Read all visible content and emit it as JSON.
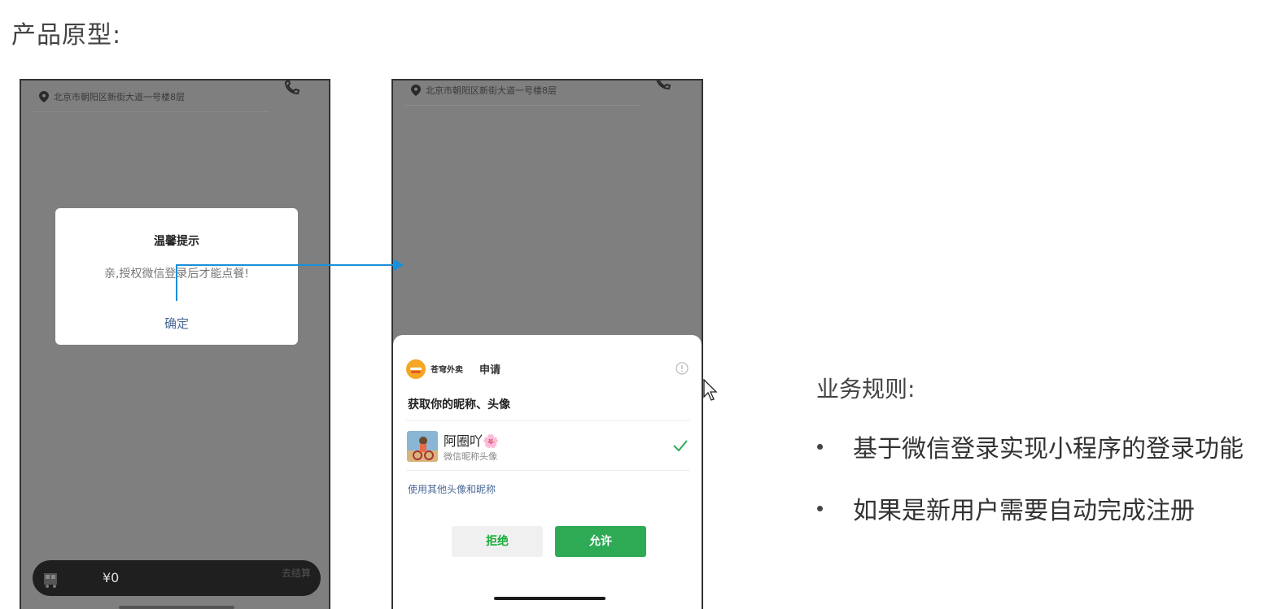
{
  "heading": "产品原型:",
  "phone1": {
    "address": "北京市朝阳区新街大道一号楼8层",
    "dialog": {
      "title": "温馨提示",
      "message": "亲,授权微信登录后才能点餐!",
      "confirm": "确定"
    },
    "cart": {
      "price": "¥0",
      "right_text": "去结算"
    }
  },
  "phone2": {
    "address": "北京市朝阳区新街大道一号楼8层",
    "sheet": {
      "app_name": "苍穹外卖",
      "request": "申请",
      "title": "获取你的昵称、头像",
      "nickname": "阿圈吖🌸",
      "nickname_sub": "微信昵称头像",
      "other_link": "使用其他头像和昵称",
      "reject": "拒绝",
      "allow": "允许"
    }
  },
  "rules": {
    "title": "业务规则:",
    "items": [
      "基于微信登录实现小程序的登录功能",
      "如果是新用户需要自动完成注册"
    ]
  },
  "colors": {
    "overlay": "#7f7f7f",
    "accent_blue": "#4a6895",
    "allow_green": "#2eaa55",
    "arrow": "#1a8fd8"
  },
  "icons": [
    "location-pin-icon",
    "phone-icon",
    "cart-icon",
    "app-logo-icon",
    "info-icon",
    "check-icon",
    "cursor-icon"
  ]
}
